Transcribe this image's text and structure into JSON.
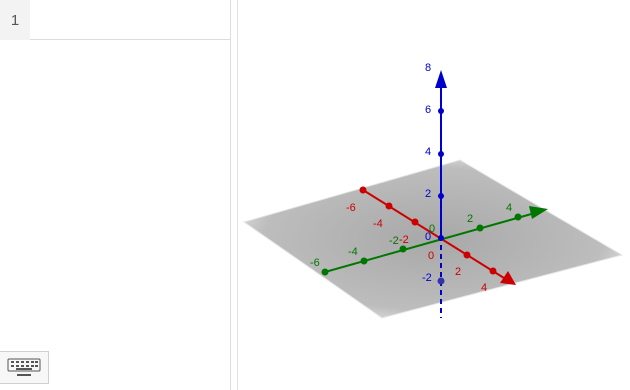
{
  "algebra": {
    "row_number": "1",
    "input_value": ""
  },
  "keyboard": {
    "icon": "keyboard-icon"
  },
  "graphics3d": {
    "colors": {
      "x_axis": "#cc0000",
      "y_axis": "#007700",
      "z_axis": "#0000cc",
      "plane": "#b3b3b3"
    },
    "x_axis_labels": [
      "-6",
      "-4",
      "-2",
      "0",
      "2",
      "4"
    ],
    "y_axis_labels": [
      "-6",
      "-4",
      "-2",
      "0",
      "2",
      "4"
    ],
    "z_axis_labels": [
      "-2",
      "0",
      "2",
      "4",
      "6",
      "8"
    ]
  }
}
